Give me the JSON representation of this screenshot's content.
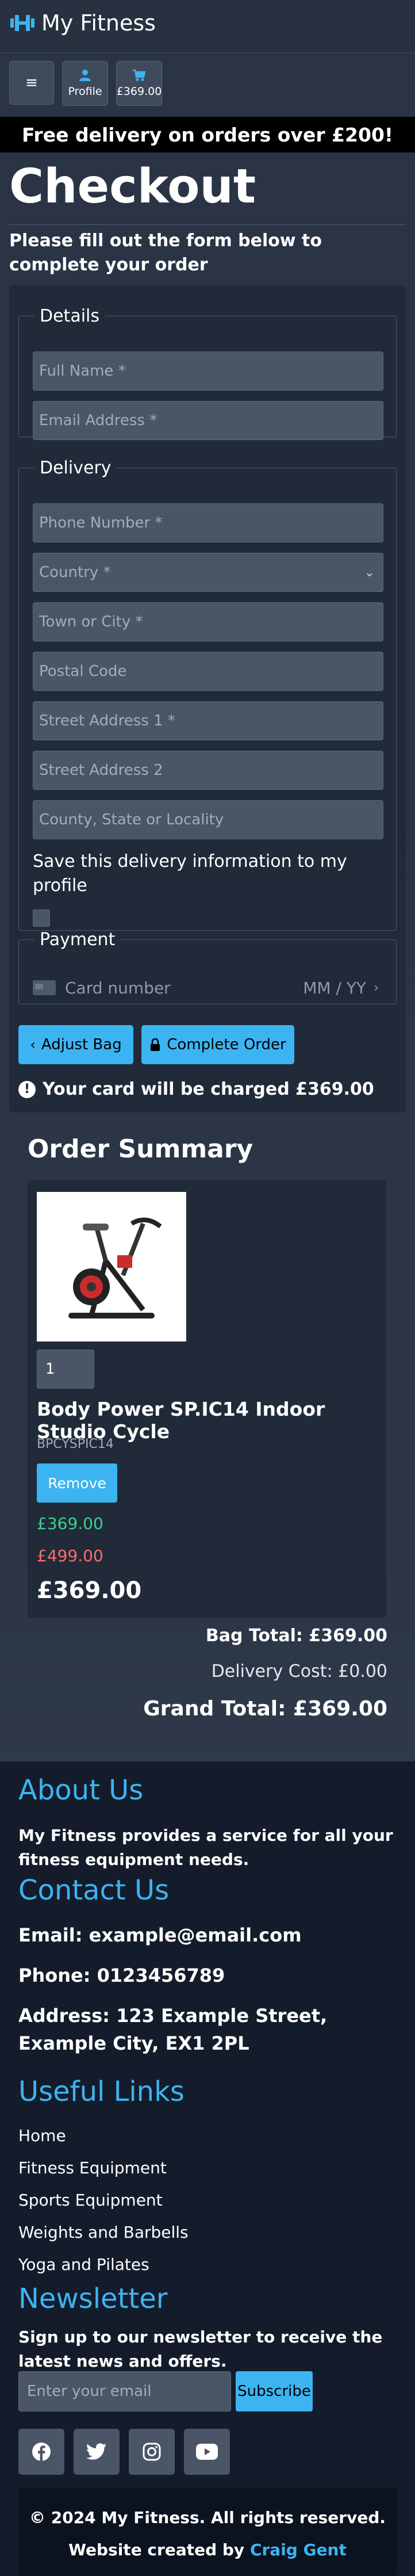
{
  "header": {
    "brand": "My Fitness",
    "menu_label": "≡",
    "profile_label": "Profile",
    "bag_total": "£369.00"
  },
  "banner": "Free delivery on orders over £200!",
  "page": {
    "title": "Checkout",
    "subtitle": "Please fill out the form below to complete your order"
  },
  "form": {
    "details_legend": "Details",
    "full_name_placeholder": "Full Name *",
    "email_placeholder": "Email Address *",
    "delivery_legend": "Delivery",
    "phone_placeholder": "Phone Number *",
    "country_placeholder": "Country *",
    "town_placeholder": "Town or City *",
    "postcode_placeholder": "Postal Code",
    "street1_placeholder": "Street Address 1 *",
    "street2_placeholder": "Street Address 2",
    "county_placeholder": "County, State or Locality",
    "save_label": "Save this delivery information to my profile",
    "save_checked": false,
    "payment_legend": "Payment",
    "card_number_placeholder": "Card number",
    "card_expiry_placeholder": "MM / YY",
    "adjust_bag_label": "Adjust Bag",
    "complete_order_label": "Complete Order",
    "charge_prefix": "Your card will be charged ",
    "charge_amount": "£369.00"
  },
  "summary": {
    "title": "Order Summary",
    "item": {
      "quantity": "1",
      "name": "Body Power SP.IC14 Indoor Studio Cycle",
      "sku": "BPCYSPIC14",
      "remove_label": "Remove",
      "sale_price": "£369.00",
      "original_price": "£499.00",
      "line_total": "£369.00"
    },
    "bag_total": "Bag Total: £369.00",
    "delivery_cost": "Delivery Cost: £0.00",
    "grand_total": "Grand Total: £369.00"
  },
  "footer": {
    "about_title": "About Us",
    "about_text": "My Fitness provides a service for all your fitness equipment needs.",
    "contact_title": "Contact Us",
    "email": "Email: example@email.com",
    "phone": "Phone: 0123456789",
    "address": "Address: 123 Example Street, Example City, EX1 2PL",
    "links_title": "Useful Links",
    "links": [
      "Home",
      "Fitness Equipment",
      "Sports Equipment",
      "Weights and Barbells",
      "Yoga and Pilates"
    ],
    "newsletter_title": "Newsletter",
    "newsletter_text": "Sign up to our newsletter to receive the latest news and offers.",
    "newsletter_placeholder": "Enter your email",
    "subscribe_label": "Subscribe",
    "social_icons": [
      "facebook-icon",
      "twitter-icon",
      "instagram-icon",
      "youtube-icon"
    ],
    "copyright": "© 2024 My Fitness. All rights reserved.",
    "credit_prefix": "Website created by ",
    "credit_name": "Craig Gent"
  },
  "colors": {
    "accent": "#3cb4f2",
    "sale": "#3ccf91",
    "was_price": "#ff6b6b",
    "card_bg": "#202a39",
    "footer_bg": "#141c2b"
  }
}
